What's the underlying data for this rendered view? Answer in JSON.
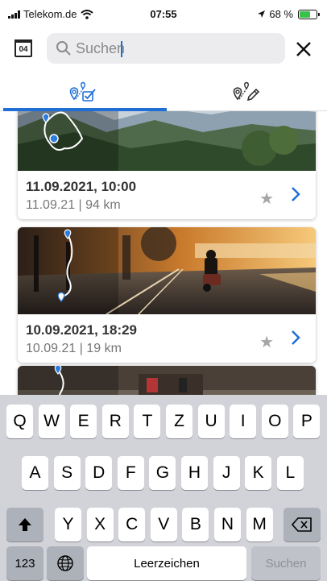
{
  "status": {
    "carrier": "Telekom.de",
    "time": "07:55",
    "battery": "68 %",
    "battery_level": 0.68
  },
  "header": {
    "calendar_day": "04",
    "search_placeholder": "Suchen"
  },
  "tabs": [
    {
      "icon": "route-checked-icon",
      "selected": true
    },
    {
      "icon": "route-edit-icon",
      "selected": false
    }
  ],
  "trips": [
    {
      "title": "11.09.2021, 10:00",
      "subtitle": "11.09.21 | 94 km"
    },
    {
      "title": "10.09.2021, 18:29",
      "subtitle": "10.09.21 | 19 km"
    }
  ],
  "keyboard": {
    "row1": [
      "Q",
      "W",
      "E",
      "R",
      "T",
      "Z",
      "U",
      "I",
      "O",
      "P"
    ],
    "row2": [
      "A",
      "S",
      "D",
      "F",
      "G",
      "H",
      "J",
      "K",
      "L"
    ],
    "row3": [
      "Y",
      "X",
      "C",
      "V",
      "B",
      "N",
      "M"
    ],
    "numbers_label": "123",
    "space_label": "Leerzeichen",
    "search_label": "Suchen"
  },
  "colors": {
    "accent": "#1f6fd6",
    "battery": "#3ac14a",
    "route": "#ffffff",
    "pin": "#2a7de1"
  }
}
